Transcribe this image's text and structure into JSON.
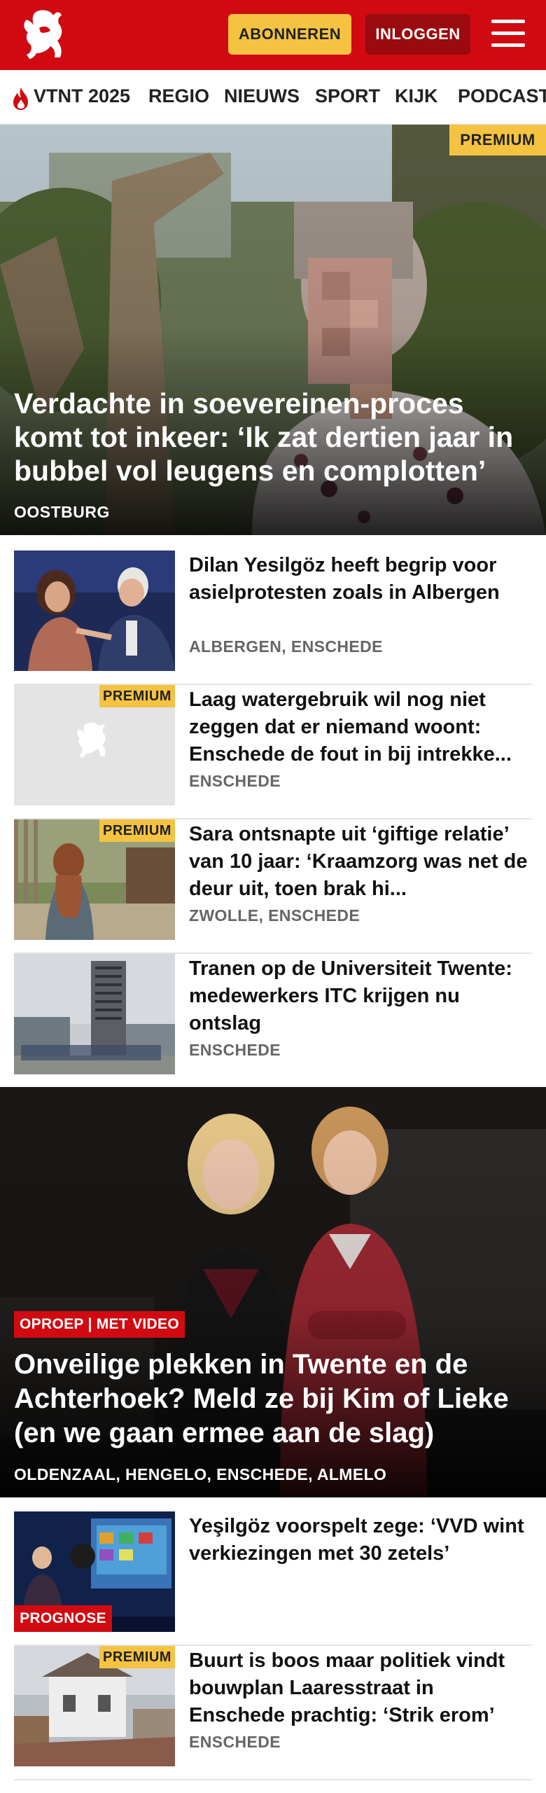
{
  "header": {
    "subscribe_label": "ABONNEREN",
    "login_label": "INLOGGEN",
    "brand_color": "#d10a11",
    "accent_color": "#f5c342"
  },
  "nav": {
    "items": [
      {
        "label": "VTNT 2025",
        "icon": "flame-icon"
      },
      {
        "label": "REGIO"
      },
      {
        "label": "NIEUWS"
      },
      {
        "label": "SPORT"
      },
      {
        "label": "KIJK"
      },
      {
        "label": "PODCAST"
      }
    ]
  },
  "hero": {
    "badge": "PREMIUM",
    "title": "Verdachte in soevereinen-proces komt tot inkeer: ‘Ik zat dertien jaar in bubbel vol leugens en complotten’",
    "place": "OOSTBURG"
  },
  "articles": [
    {
      "title": "Dilan Yesilgöz heeft begrip voor asielprotesten zoals in Albergen",
      "place": "ALBERGEN, ENSCHEDE"
    },
    {
      "badge": "PREMIUM",
      "title": "Laag watergebruik wil nog niet zeggen dat er niemand woont: Enschede de fout in bij intrekke...",
      "place": "ENSCHEDE"
    },
    {
      "badge": "PREMIUM",
      "title": "Sara ontsnapte uit ‘giftige relatie’ van 10 jaar: ‘Kraamzorg was net de deur uit, toen brak hi...",
      "place": "ZWOLLE, ENSCHEDE"
    },
    {
      "title": "Tranen op de Universiteit Twente: medewerkers ITC krijgen nu ontslag",
      "place": "ENSCHEDE"
    }
  ],
  "feature": {
    "tag": "OPROEP | MET VIDEO",
    "title": "Onveilige plekken in Twente en de Achterhoek? Meld ze bij Kim of Lieke (en we gaan ermee aan de slag)",
    "place": "OLDENZAAL, HENGELO, ENSCHEDE, ALMELO"
  },
  "articles2": [
    {
      "tag": "PROGNOSE",
      "title": "Yeşilgöz voorspelt zege: ‘VVD wint verkiezingen met 30 zetels’"
    },
    {
      "badge": "PREMIUM",
      "title": "Buurt is boos maar politiek vindt bouwplan Laaresstraat in Enschede prachtig: ‘Strik erom’",
      "place": "ENSCHEDE"
    }
  ]
}
